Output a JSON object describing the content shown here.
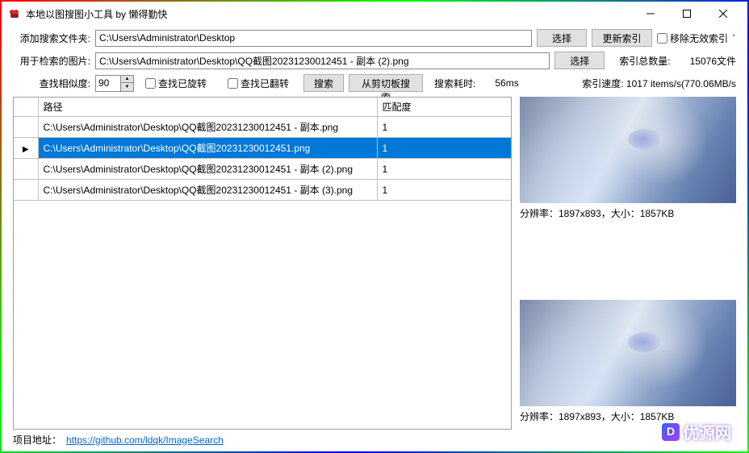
{
  "window": {
    "title": "本地以图搜图小工具 by 懒得勤快"
  },
  "row1": {
    "label": "添加搜索文件夹:",
    "value": "C:\\Users\\Administrator\\Desktop",
    "choose": "选择",
    "updateIndex": "更新索引",
    "removeInvalid": "移除无效索引"
  },
  "row2": {
    "label": "用于检索的图片:",
    "value": "C:\\Users\\Administrator\\Desktop\\QQ截图20231230012451 - 副本 (2).png",
    "choose": "选择",
    "indexCountLabel": "索引总数量:",
    "indexCountValue": "15076文件"
  },
  "row3": {
    "label": "查找相似度:",
    "value": "90",
    "cbRotated": "查找已旋转",
    "cbFlipped": "查找已翻转",
    "search": "搜索",
    "clipSearch": "从剪切板搜索",
    "elapsedLabel": "搜索耗时:",
    "elapsedValue": "56ms",
    "speed": "索引速度: 1017 items/s(770.06MB/s"
  },
  "table": {
    "colPath": "路径",
    "colMatch": "匹配度",
    "rows": [
      {
        "path": "C:\\Users\\Administrator\\Desktop\\QQ截图20231230012451 - 副本.png",
        "match": "1",
        "selected": false
      },
      {
        "path": "C:\\Users\\Administrator\\Desktop\\QQ截图20231230012451.png",
        "match": "1",
        "selected": true
      },
      {
        "path": "C:\\Users\\Administrator\\Desktop\\QQ截图20231230012451 - 副本 (2).png",
        "match": "1",
        "selected": false
      },
      {
        "path": "C:\\Users\\Administrator\\Desktop\\QQ截图20231230012451 - 副本 (3).png",
        "match": "1",
        "selected": false
      }
    ]
  },
  "preview1": {
    "caption": "分辨率：1897x893，大小：1857KB"
  },
  "preview2": {
    "caption": "分辨率：1897x893，大小：1857KB"
  },
  "footer": {
    "label": "项目地址：",
    "link": "https://github.com/ldqk/ImageSearch"
  },
  "watermark": "优源网"
}
